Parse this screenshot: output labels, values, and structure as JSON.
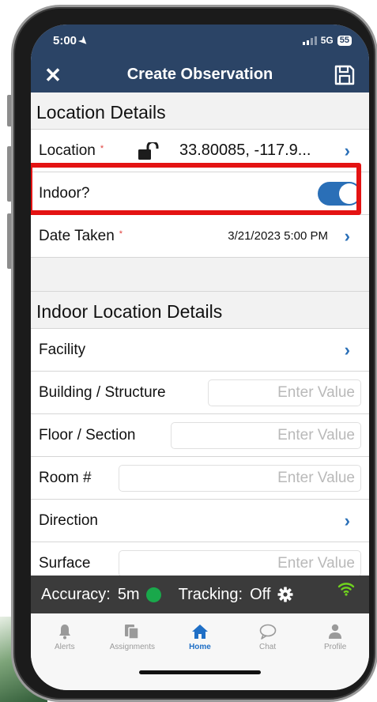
{
  "status_bar": {
    "time": "5:00",
    "network": "5G",
    "battery": "55"
  },
  "navbar": {
    "title": "Create Observation"
  },
  "location_details": {
    "header": "Location Details",
    "location_label": "Location",
    "location_value": "33.80085, -117.9...",
    "indoor_label": "Indoor?",
    "indoor_on": true,
    "date_label": "Date Taken",
    "date_value": "3/21/2023 5:00 PM"
  },
  "indoor_details": {
    "header": "Indoor Location Details",
    "facility_label": "Facility",
    "building_label": "Building / Structure",
    "floor_label": "Floor / Section",
    "room_label": "Room #",
    "direction_label": "Direction",
    "surface_label": "Surface",
    "placeholder": "Enter Value"
  },
  "tracking": {
    "accuracy_label": "Accuracy:",
    "accuracy_value": "5m",
    "tracking_label": "Tracking:",
    "tracking_value": "Off"
  },
  "tabs": [
    {
      "label": "Alerts",
      "icon": "bell-icon"
    },
    {
      "label": "Assignments",
      "icon": "clipboard-icon"
    },
    {
      "label": "Home",
      "icon": "home-icon",
      "active": true
    },
    {
      "label": "Chat",
      "icon": "chat-icon"
    },
    {
      "label": "Profile",
      "icon": "person-icon"
    }
  ],
  "colors": {
    "navbar": "#2b4466",
    "accent": "#2a6fb7",
    "highlight": "#e41313",
    "accuracy_ok": "#19a84b"
  }
}
